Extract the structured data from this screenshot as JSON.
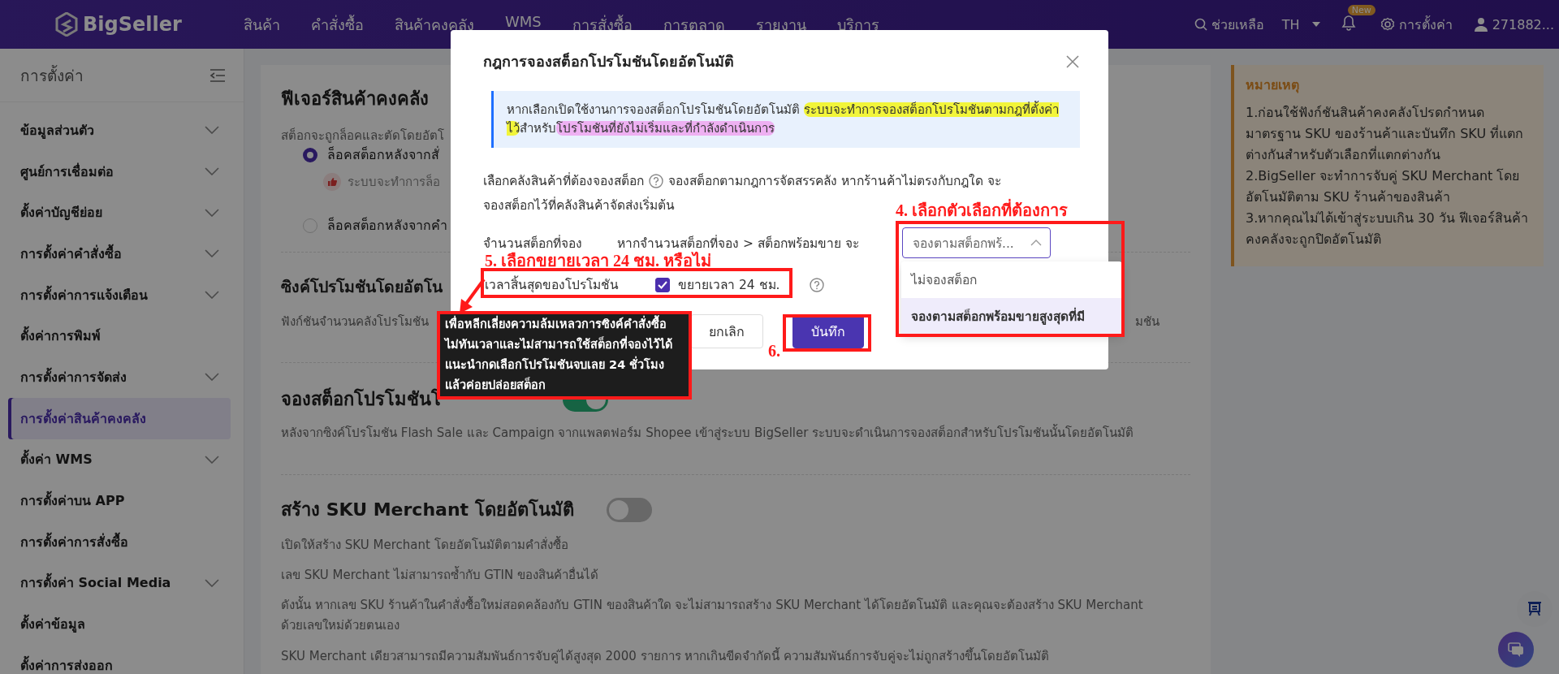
{
  "topbar": {
    "logo": "BigSeller",
    "menu": [
      "สินค้า",
      "คำสั่งซื้อ",
      "สินค้าคงคลัง",
      "WMS",
      "การสั่งซื้อ",
      "การตลาด",
      "รายงาน",
      "บริการ"
    ],
    "help": "ช่วยเหลือ",
    "language": "TH",
    "notification_badge": "New",
    "settings": "การตั้งค่า",
    "user": "271882..."
  },
  "sidebar": {
    "title": "การตั้งค่า",
    "items": [
      {
        "label": "ข้อมูลส่วนตัว",
        "collapsible": true,
        "selected": false
      },
      {
        "label": "ศูนย์การเชื่อมต่อ",
        "collapsible": true,
        "selected": false
      },
      {
        "label": "ตั้งค่าบัญชีย่อย",
        "collapsible": true,
        "selected": false
      },
      {
        "label": "การตั้งค่าคำสั่งซื้อ",
        "collapsible": true,
        "selected": false
      },
      {
        "label": "การตั้งค่าการแจ้งเตือน",
        "collapsible": true,
        "selected": false
      },
      {
        "label": "ตั้งค่าการพิมพ์",
        "collapsible": false,
        "selected": false
      },
      {
        "label": "การตั้งค่าการจัดส่ง",
        "collapsible": true,
        "selected": false
      },
      {
        "label": "การตั้งค่าสินค้าคงคลัง",
        "collapsible": false,
        "selected": true
      },
      {
        "label": "ตั้งค่า WMS",
        "collapsible": true,
        "selected": false
      },
      {
        "label": "การตั้งค่าบน APP",
        "collapsible": false,
        "selected": false
      },
      {
        "label": "การตั้งค่าการสั่งซื้อ",
        "collapsible": false,
        "selected": false
      },
      {
        "label": "การตั้งค่า Social Media",
        "collapsible": true,
        "selected": false
      },
      {
        "label": "ตั้งค่าข้อมูล",
        "collapsible": false,
        "selected": false
      },
      {
        "label": "ตั้งค่าการส่งออก",
        "collapsible": false,
        "selected": false
      }
    ]
  },
  "inventory_feature": {
    "title": "ฟีเจอร์สินค้าคงคลัง",
    "description": "สต็อกจะถูกล็อคและตัดโดยอัตโ",
    "options": [
      {
        "label": "ล็อคสต็อกหลังจากสั่",
        "selected": true,
        "hint": "ระบบจะทำการล็อ"
      },
      {
        "label": "ล็อคสต็อกหลังจากคำ",
        "selected": false
      }
    ]
  },
  "promotion_sync": {
    "title": "ซิงค์โปรโมชันโดยอัตโน",
    "description": "ฟังก์ชันจำนวนคลังโปรโมชัน",
    "description_tail": "มชัน"
  },
  "promotion_reserve": {
    "title": "จองสต็อกโปรโมชันโ",
    "on": true,
    "description": "หลังจากซิงค์โปรโมชัน Flash Sale และ Campaign จากแพลตฟอร์ม Shopee เข้าสู่ระบบ BigSeller ระบบจะดำเนินการจองสต็อกสำหรับโปรโมชันนั้นโดยอัตโนมัติ"
  },
  "sku_merchant": {
    "title": "สร้าง SKU Merchant โดยอัตโนมัติ",
    "on": false,
    "lines": [
      "เปิดให้สร้าง SKU Merchant โดยอัตโนมัติตามคำสั่งซื้อ",
      "เลข SKU Merchant ไม่สามารถซ้ำกับ GTIN ของสินค้าอื่นได้",
      "ดังนั้น หากเลข SKU ร้านค้าในคำสั่งซื้อใหม่สอดคล้องกับ GTIN ของสินค้าใด จะไม่สามารถสร้าง SKU Merchant ได้โดยอัตโนมัติ และคุณจะต้องสร้าง SKU Merchant ด้วยเลขใหม่ด้วยตนเอง",
      "SKU Merchant เดียวสามารถมีความสัมพันธ์การจับคู่ได้สูงสุด 2000 รายการ หากเกินขีดจำกัดนี้ ความสัมพันธ์การจับคู่จะไม่ถูกสร้างขึ้นโดยอัตโนมัติ"
    ]
  },
  "notes": {
    "title": "หมายเหตุ",
    "items": [
      "1.ก่อนใช้ฟังก์ชันสินค้าคงคลังโปรดกำหนดมาตรฐาน SKU ของร้านค้าและบันทึก SKU ที่แตกต่างกันสำหรับตัวเลือกที่แตกต่างกัน",
      "2.BigSeller จะทำการจับคู่ SKU Merchant โดยอัตโนมัติตาม SKU ร้านค้าของสินค้า",
      "3.หากคุณไม่ได้เข้าสู่ระบบเกิน 30 วัน ฟีเจอร์สินค้าคงคลังจะถูกปิดอัตโนมัติ"
    ]
  },
  "modal": {
    "title": "กฎการจองสต็อกโปรโมชันโดยอัตโนมัติ",
    "info_segments": [
      {
        "text": "หากเลือกเปิดใช้งานการจองสต็อกโปรโมชันโดยอัตโนมัติ "
      },
      {
        "text": "ระบบจะทำการจองสต็อกโปรโมชันตามกฎที่ตั้งค่าไว้",
        "color": "#f2f53a"
      },
      {
        "text": "สำหรับ"
      },
      {
        "text": "โปรโมชันที่ยังไม่เริ่มและที่กำลังดำเนินการ",
        "color": "#eeb0f2"
      }
    ],
    "warehouse": {
      "label": "เลือกคลังสินค้าที่ต้องจองสต็อก",
      "description_lines": [
        "จองสต็อกตามกฎการจัดสรรคลัง หากร้านค้าไม่ตรงกับกฎใด จะ",
        "จองสต็อกไว้ที่คลังสินค้าจัดส่งเริ่มต้น"
      ]
    },
    "quantity": {
      "label": "จำนวนสต็อกที่จอง",
      "condition": "หากจำนวนสต็อกที่จอง > สต็อกพร้อมขาย จะ",
      "select_value": "จองตามสต็อกพร้...",
      "expanded": true,
      "options": [
        {
          "label": "ไม่จองสต็อก",
          "selected": false
        },
        {
          "label": "จองตามสต็อกพร้อมขายสูงสุดที่มี",
          "selected": true
        }
      ]
    },
    "end_time": {
      "label": "เวลาสิ้นสุดของโปรโมชัน",
      "checkbox_label": "ขยายเวลา 24 ชม.",
      "checked": true
    },
    "buttons": [
      {
        "label": "ยกเลิก",
        "kind": "secondary"
      },
      {
        "label": "บันทึก",
        "kind": "primary"
      }
    ],
    "tooltip": "เพื่อหลีกเลี่ยงความล้มเหลวการซิงค์คำสั่งซื้อไม่ทันเวลาและไม่สามารถใช้สต็อกที่จองไว้ได้ แนะนำกดเลือกโปรโมชันจบเลย 24 ชั่วโมงแล้วค่อยปล่อยสต็อก"
  },
  "annotations": [
    {
      "text": "4. เลือกตัวเลือกที่ต้องการ"
    },
    {
      "text": "5. เลือกขยายเวลา 24 ชม. หรือไม่"
    },
    {
      "text": "6."
    }
  ]
}
